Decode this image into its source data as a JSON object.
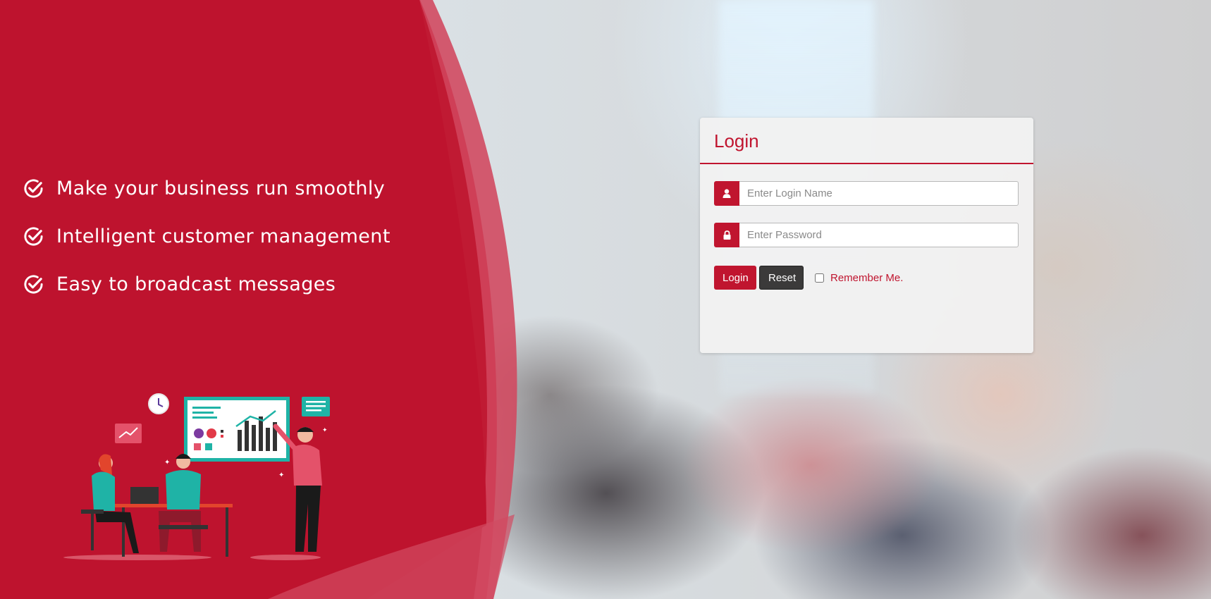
{
  "features": [
    {
      "text": "Make your business run smoothly"
    },
    {
      "text": "Intelligent customer management"
    },
    {
      "text": "Easy to broadcast messages"
    }
  ],
  "login": {
    "title": "Login",
    "username_placeholder": "Enter Login Name",
    "password_placeholder": "Enter Password",
    "login_label": "Login",
    "reset_label": "Reset",
    "remember_label": "Remember Me.",
    "remember_checked": false
  },
  "colors": {
    "brand_red": "#c0152f",
    "reset_dark": "#3b3a3a",
    "panel_text": "#ffffff"
  },
  "icons": {
    "feature": "check-circle-icon",
    "username": "user-icon",
    "password": "lock-icon"
  }
}
